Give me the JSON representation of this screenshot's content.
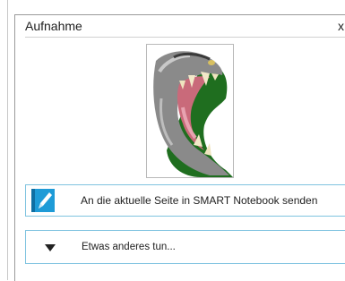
{
  "dialog": {
    "title": "Aufnahme",
    "close_glyph": "x",
    "close_icon": "close-icon"
  },
  "capture": {
    "thumbnail": "captured-image"
  },
  "actions": [
    {
      "label": "An die aktuelle Seite in SMART Notebook senden",
      "icon": "notebook-pen-icon"
    },
    {
      "label": "Etwas anderes tun...",
      "icon": "triangle-down-icon"
    }
  ],
  "colors": {
    "accent_border": "#7fc3e0",
    "notebook_icon": "#1e9bd7",
    "divider": "#d0d0d0"
  }
}
